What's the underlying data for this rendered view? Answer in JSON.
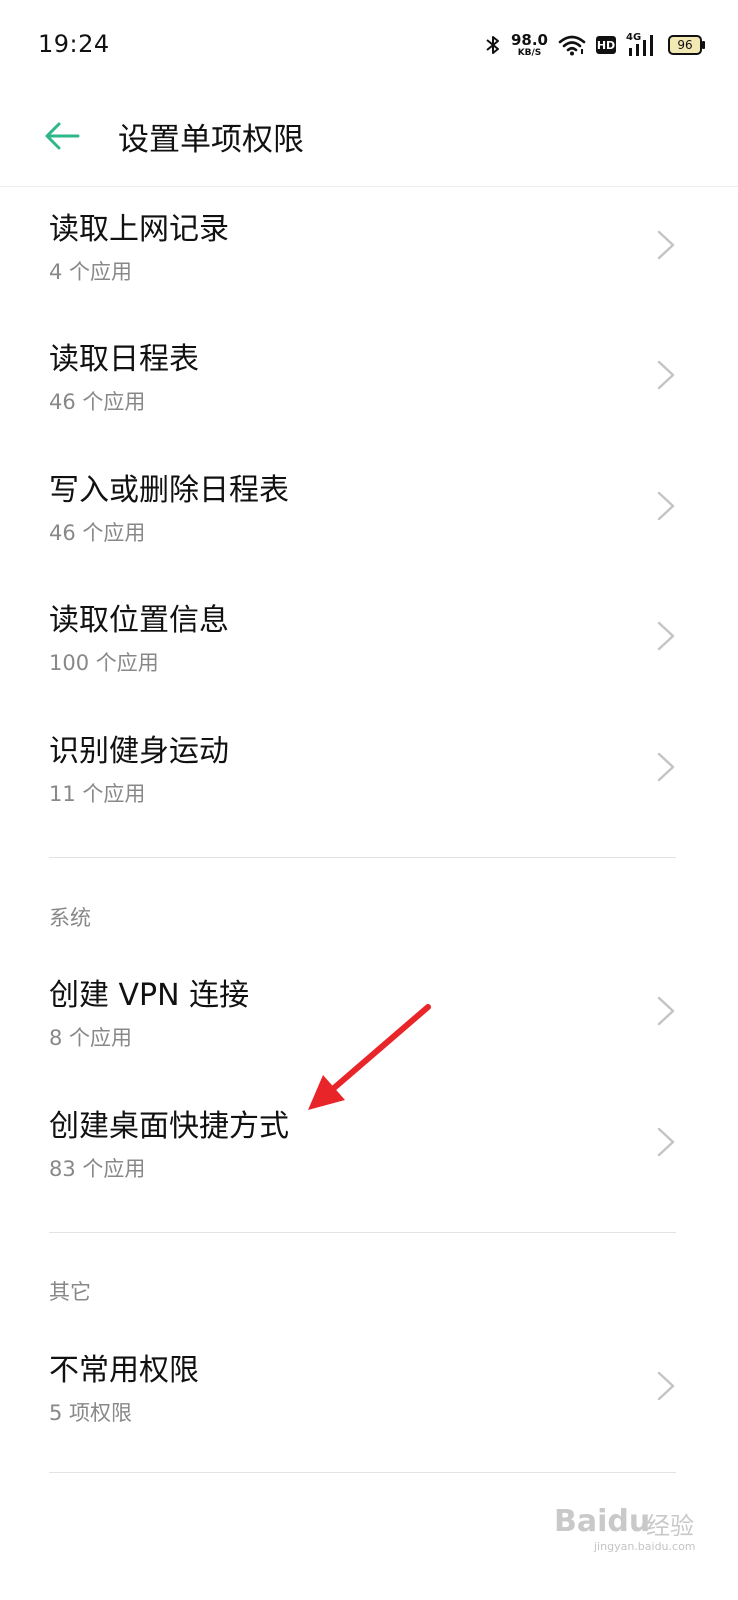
{
  "status_bar": {
    "time": "19:24",
    "net_speed": "98.0",
    "net_unit": "KB/S",
    "hd": "HD",
    "signal_label": "4G",
    "battery": "96"
  },
  "header": {
    "title": "设置单项权限",
    "back_icon": "back-arrow-icon",
    "accent": "#2eb88a"
  },
  "items": [
    {
      "name": "读取上网记录",
      "sub": "4 个应用"
    },
    {
      "name": "读取日程表",
      "sub": "46 个应用"
    },
    {
      "name": "写入或删除日程表",
      "sub": "46 个应用"
    },
    {
      "name": "读取位置信息",
      "sub": "100 个应用"
    },
    {
      "name": "识别健身运动",
      "sub": "11 个应用"
    }
  ],
  "system": {
    "label": "系统",
    "items": [
      {
        "name": "创建 VPN 连接",
        "sub": "8 个应用"
      },
      {
        "name": "创建桌面快捷方式",
        "sub": "83 个应用"
      }
    ]
  },
  "other": {
    "label": "其它",
    "items": [
      {
        "name": "不常用权限",
        "sub": "5 项权限"
      }
    ]
  },
  "annotation": {
    "arrow_color": "#e8262a"
  },
  "watermark": {
    "logo": "Baidu",
    "brand": "经验",
    "url": "jingyan.baidu.com"
  }
}
